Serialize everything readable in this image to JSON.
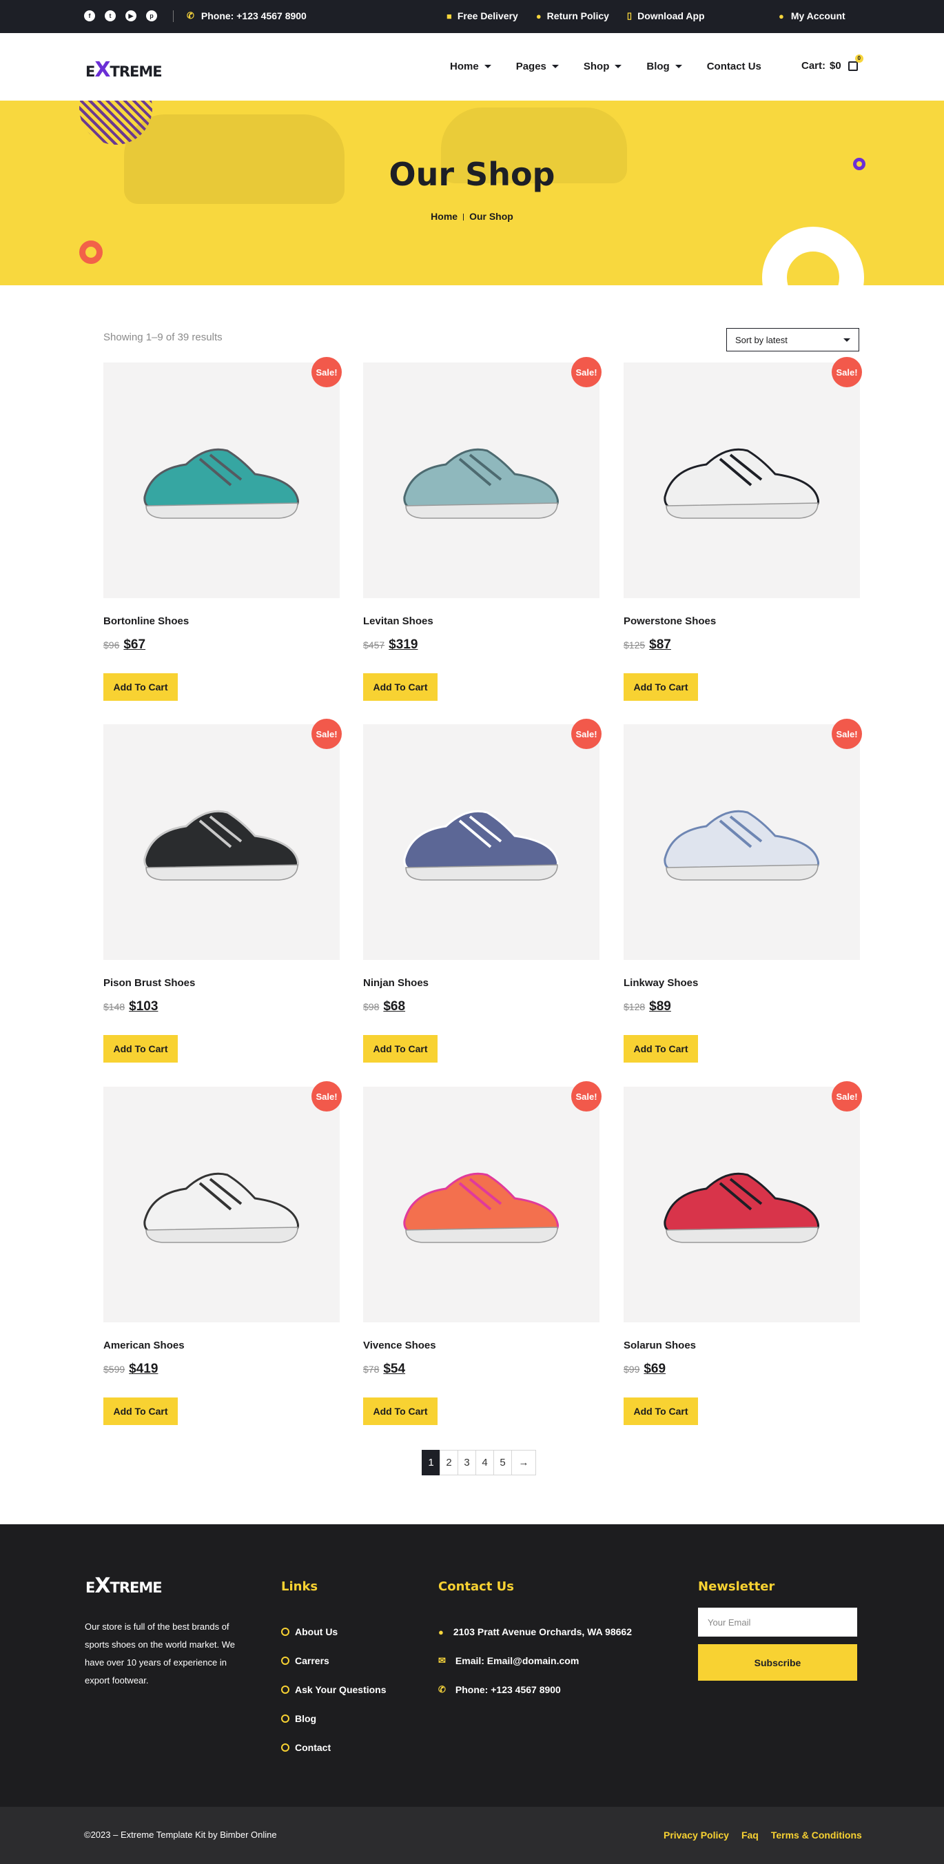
{
  "topbar": {
    "social": [
      "f",
      "t",
      "▶",
      "p"
    ],
    "phone": "Phone: +123 4567 8900",
    "free_delivery": "Free Delivery",
    "return_policy": "Return Policy",
    "download_app": "Download App",
    "my_account": "My Account"
  },
  "nav": {
    "logo_mark": "X",
    "logo_left": "E",
    "logo_right": "TREME",
    "menu": [
      "Home",
      "Pages",
      "Shop",
      "Blog",
      "Contact Us"
    ],
    "cart_label": "Cart:",
    "cart_total": "$0",
    "cart_count": "0"
  },
  "hero": {
    "title": "Our Shop",
    "breadcrumb_home": "Home",
    "breadcrumb_current": "Our Shop"
  },
  "shop": {
    "result_count": "Showing 1–9 of 39 results",
    "sort_label": "Sort by latest",
    "sale_badge": "Sale!",
    "add_to_cart": "Add To Cart",
    "products": [
      {
        "name": "Bortonline Shoes",
        "old_price": "$96",
        "price": "$67",
        "color": "#36a6a2",
        "accent": "#555a60"
      },
      {
        "name": "Levitan Shoes",
        "old_price": "$457",
        "price": "$319",
        "color": "#8fb8bd",
        "accent": "#4d6a70"
      },
      {
        "name": "Powerstone Shoes",
        "old_price": "$125",
        "price": "$87",
        "color": "#f0f0f0",
        "accent": "#1d1f26"
      },
      {
        "name": "Pison Brust Shoes",
        "old_price": "$148",
        "price": "$103",
        "color": "#2a2c2e",
        "accent": "#c9c9c9"
      },
      {
        "name": "Ninjan Shoes",
        "old_price": "$98",
        "price": "$68",
        "color": "#5c6796",
        "accent": "#ffffff"
      },
      {
        "name": "Linkway Shoes",
        "old_price": "$128",
        "price": "$89",
        "color": "#dfe4ee",
        "accent": "#6e86b3"
      },
      {
        "name": "American Shoes",
        "old_price": "$599",
        "price": "$419",
        "color": "#f2f2f2",
        "accent": "#333333"
      },
      {
        "name": "Vivence Shoes",
        "old_price": "$78",
        "price": "$54",
        "color": "#f3704e",
        "accent": "#e03a9b"
      },
      {
        "name": "Solarun Shoes",
        "old_price": "$99",
        "price": "$69",
        "color": "#d8344a",
        "accent": "#1d1f26"
      }
    ],
    "pagination": [
      "1",
      "2",
      "3",
      "4",
      "5",
      "→"
    ]
  },
  "footer": {
    "logo_mark": "X",
    "logo_left": "E",
    "logo_right": "TREME",
    "about": "Our store is full of the best brands of sports shoes on the world market. We have over 10 years of experience in export footwear.",
    "links_title": "Links",
    "links": [
      "About Us",
      "Carrers",
      "Ask Your Questions",
      "Blog",
      "Contact"
    ],
    "contact_title": "Contact Us",
    "address": "2103 Pratt Avenue Orchards, WA 98662",
    "email": "Email: Email@domain.com",
    "phone": "Phone: +123 4567 8900",
    "newsletter_title": "Newsletter",
    "email_placeholder": "Your Email",
    "subscribe": "Subscribe",
    "copyright": "©2023 – Extreme Template Kit by Bimber Online",
    "bottom_links": [
      "Privacy Policy",
      "Faq",
      "Terms & Conditions"
    ]
  },
  "colors": {
    "accent": "#f8d232",
    "brand": "#6b2fd6",
    "dark": "#1d1f26",
    "sale": "#f2594b"
  }
}
